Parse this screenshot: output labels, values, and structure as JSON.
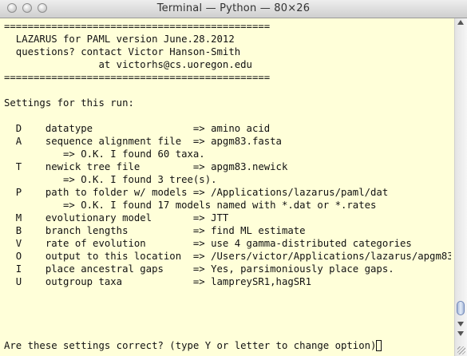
{
  "window": {
    "title": "Terminal — Python — 80×26"
  },
  "terminal": {
    "lines": [
      "=============================================",
      "  LAZARUS for PAML version June.28.2012",
      "  questions? contact Victor Hanson-Smith",
      "                at victorhs@cs.uoregon.edu",
      "=============================================",
      "",
      "Settings for this run:",
      "",
      "  D    datatype                 => amino acid",
      "  A    sequence alignment file  => apgm83.fasta",
      "          => O.K. I found 60 taxa.",
      "  T    newick tree file         => apgm83.newick",
      "          => O.K. I found 3 tree(s).",
      "  P    path to folder w/ models => /Applications/lazarus/paml/dat",
      "          => O.K. I found 17 models named with *.dat or *.rates",
      "  M    evolutionary model       => JTT",
      "  B    branch lengths           => find ML estimate",
      "  V    rate of evolution        => use 4 gamma-distributed categories",
      "  O    output to this location  => /Users/victor/Applications/lazarus/apgm83",
      "  I    place ancestral gaps     => Yes, parsimoniously place gaps.",
      "  U    outgroup taxa            => lampreySR1,hagSR1",
      "",
      "",
      "",
      "",
      "Are these settings correct? (type Y or letter to change option)"
    ]
  },
  "icons": {
    "close": "close-icon",
    "minimize": "minimize-icon",
    "zoom": "zoom-icon"
  }
}
